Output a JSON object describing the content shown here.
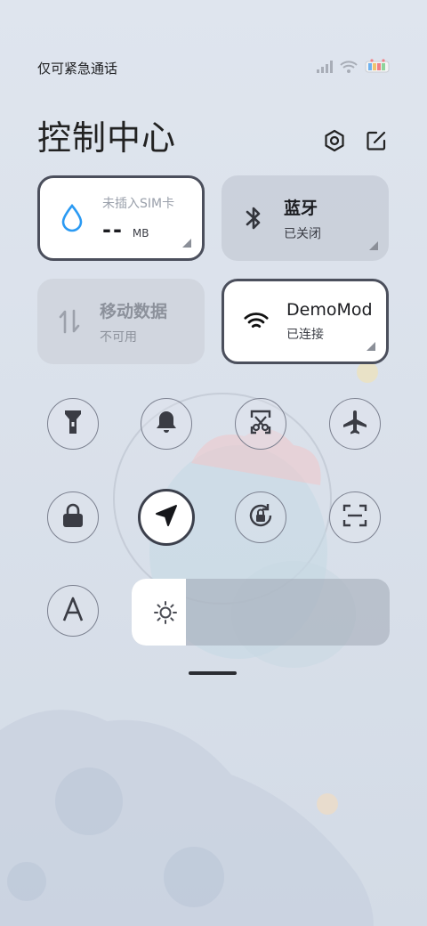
{
  "status_bar": {
    "carrier_text": "仅可紧急通话",
    "icons": [
      "signal-icon",
      "wifi-icon",
      "battery-icon"
    ]
  },
  "header": {
    "title": "控制中心",
    "buttons": [
      "settings-icon",
      "edit-icon"
    ]
  },
  "tiles": {
    "sim": {
      "label": "未插入SIM卡",
      "value": "--",
      "unit": "MB",
      "icon": "water-drop-icon"
    },
    "bluetooth": {
      "title": "蓝牙",
      "status": "已关闭",
      "icon": "bluetooth-icon"
    },
    "mobile_data": {
      "title": "移动数据",
      "status": "不可用",
      "icon": "data-transfer-icon"
    },
    "wifi": {
      "title": "DemoMod",
      "status": "已连接",
      "icon": "wifi-icon"
    }
  },
  "toggles": [
    {
      "name": "flashlight",
      "icon": "flashlight-icon",
      "active": false
    },
    {
      "name": "silent",
      "icon": "bell-icon",
      "active": false
    },
    {
      "name": "screenshot",
      "icon": "scissors-screenshot-icon",
      "active": false
    },
    {
      "name": "airplane",
      "icon": "airplane-icon",
      "active": false
    },
    {
      "name": "lock-screen",
      "icon": "lock-icon",
      "active": false
    },
    {
      "name": "location",
      "icon": "location-arrow-icon",
      "active": true
    },
    {
      "name": "rotation-lock",
      "icon": "rotation-lock-icon",
      "active": false
    },
    {
      "name": "scanner",
      "icon": "scan-icon",
      "active": false
    },
    {
      "name": "reading-mode",
      "icon": "font-a-icon",
      "active": false
    }
  ],
  "brightness": {
    "icon": "sun-icon",
    "level_fraction": 0.21
  },
  "colors": {
    "active_border": "#4b4f5c",
    "wifi_blue": "#2b9af3",
    "background": "#dfe5ee"
  }
}
